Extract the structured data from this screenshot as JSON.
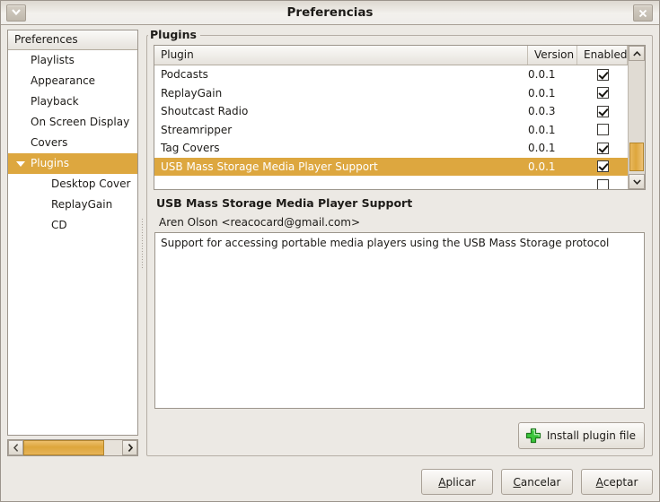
{
  "window": {
    "title": "Preferencias",
    "menu_icon": "chevron-down-icon",
    "close_icon": "close-icon"
  },
  "sidebar": {
    "header": "Preferences",
    "items": [
      {
        "label": "Playlists",
        "level": 1,
        "selected": false,
        "expander": false
      },
      {
        "label": "Appearance",
        "level": 1,
        "selected": false,
        "expander": false
      },
      {
        "label": "Playback",
        "level": 1,
        "selected": false,
        "expander": false
      },
      {
        "label": "On Screen Display",
        "level": 1,
        "selected": false,
        "expander": false
      },
      {
        "label": "Covers",
        "level": 1,
        "selected": false,
        "expander": false
      },
      {
        "label": "Plugins",
        "level": 1,
        "selected": true,
        "expander": true
      },
      {
        "label": "Desktop Cover",
        "level": 2,
        "selected": false,
        "expander": false
      },
      {
        "label": "ReplayGain",
        "level": 2,
        "selected": false,
        "expander": false
      },
      {
        "label": "CD",
        "level": 2,
        "selected": false,
        "expander": false
      }
    ]
  },
  "main": {
    "group_label": "Plugins",
    "columns": [
      "Plugin",
      "Version",
      "Enabled"
    ],
    "rows": [
      {
        "name": "Podcasts",
        "version": "0.0.1",
        "enabled": true,
        "selected": false
      },
      {
        "name": "ReplayGain",
        "version": "0.0.1",
        "enabled": true,
        "selected": false
      },
      {
        "name": "Shoutcast Radio",
        "version": "0.0.3",
        "enabled": true,
        "selected": false
      },
      {
        "name": "Streamripper",
        "version": "0.0.1",
        "enabled": false,
        "selected": false
      },
      {
        "name": "Tag Covers",
        "version": "0.0.1",
        "enabled": true,
        "selected": false
      },
      {
        "name": "USB Mass Storage Media Player Support",
        "version": "0.0.1",
        "enabled": true,
        "selected": true
      }
    ],
    "detail": {
      "title": "USB Mass Storage Media Player Support",
      "author": "Aren Olson <reacocard@gmail.com>",
      "description": "Support for accessing portable media players using the USB Mass Storage protocol"
    },
    "install_button": {
      "label": "Install plugin file",
      "icon": "plus-icon"
    }
  },
  "footer": {
    "buttons": [
      {
        "mnemonic": "A",
        "rest": "plicar"
      },
      {
        "mnemonic": "C",
        "rest": "ancelar"
      },
      {
        "mnemonic": "A",
        "rest": "ceptar"
      }
    ]
  },
  "colors": {
    "selection": "#dda73f",
    "window_bg": "#ece9e4",
    "accent_green": "#3cc63c"
  }
}
